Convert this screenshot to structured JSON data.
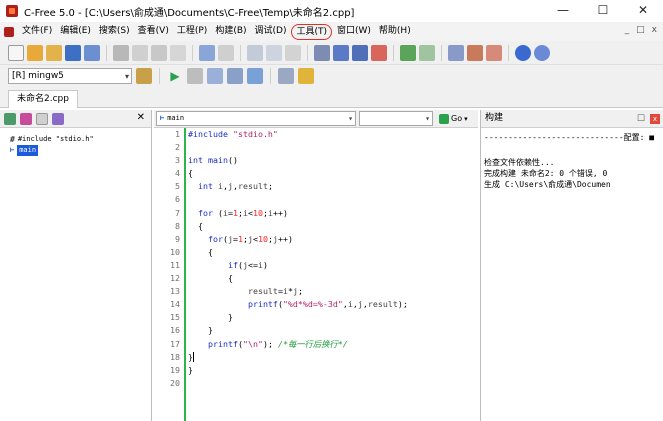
{
  "window": {
    "title": "C-Free 5.0 - [C:\\Users\\俞成通\\Documents\\C-Free\\Temp\\未命名2.cpp]",
    "controls": [
      "—",
      "☐",
      "✕"
    ]
  },
  "menu": {
    "items": [
      "文件(F)",
      "编辑(E)",
      "搜索(S)",
      "查看(V)",
      "工程(P)",
      "构建(B)",
      "调试(D)",
      "工具(T)",
      "窗口(W)",
      "帮助(H)"
    ],
    "highlighted_index": 7,
    "mdi_controls": [
      "_",
      "□",
      "x"
    ]
  },
  "toolbar": {
    "compiler": "[R] mingw5"
  },
  "file_tab": "未命名2.cpp",
  "class_tree": {
    "include": "#include \"stdio.h\"",
    "function": "main"
  },
  "editor": {
    "function_combo": "main",
    "go_label": "Go",
    "lines": [
      "#include \"stdio.h\"",
      "",
      "int main()",
      "{",
      "  int i,j,result;",
      "",
      "  for (i=1;i<10;i++)",
      "  {",
      "    for(j=1;j<10;j++)",
      "    {",
      "        if(j<=i)",
      "        {",
      "            result=i*j;",
      "            printf(\"%d*%d=%-3d\",i,j,result);",
      "        }",
      "    }",
      "    printf(\"\\n\"); /*每一行后换行*/",
      "}",
      "}",
      ""
    ]
  },
  "build_panel": {
    "title": "构建",
    "pin": "☐",
    "close": "x",
    "separator": "-----------------------------配置: ■",
    "lines": [
      "检查文件依赖性...",
      "",
      "完成构建 未命名2: 0 个错误, 0",
      "生成 C:\\Users\\俞成通\\Documen"
    ]
  },
  "colors": {
    "accent_green": "#2fb34d",
    "keyword_blue": "#1a2ec8",
    "number_red": "#ff2020",
    "string_magenta": "#b0206a",
    "comment_green": "#1e9a3c",
    "highlight_red": "#e0302a"
  }
}
